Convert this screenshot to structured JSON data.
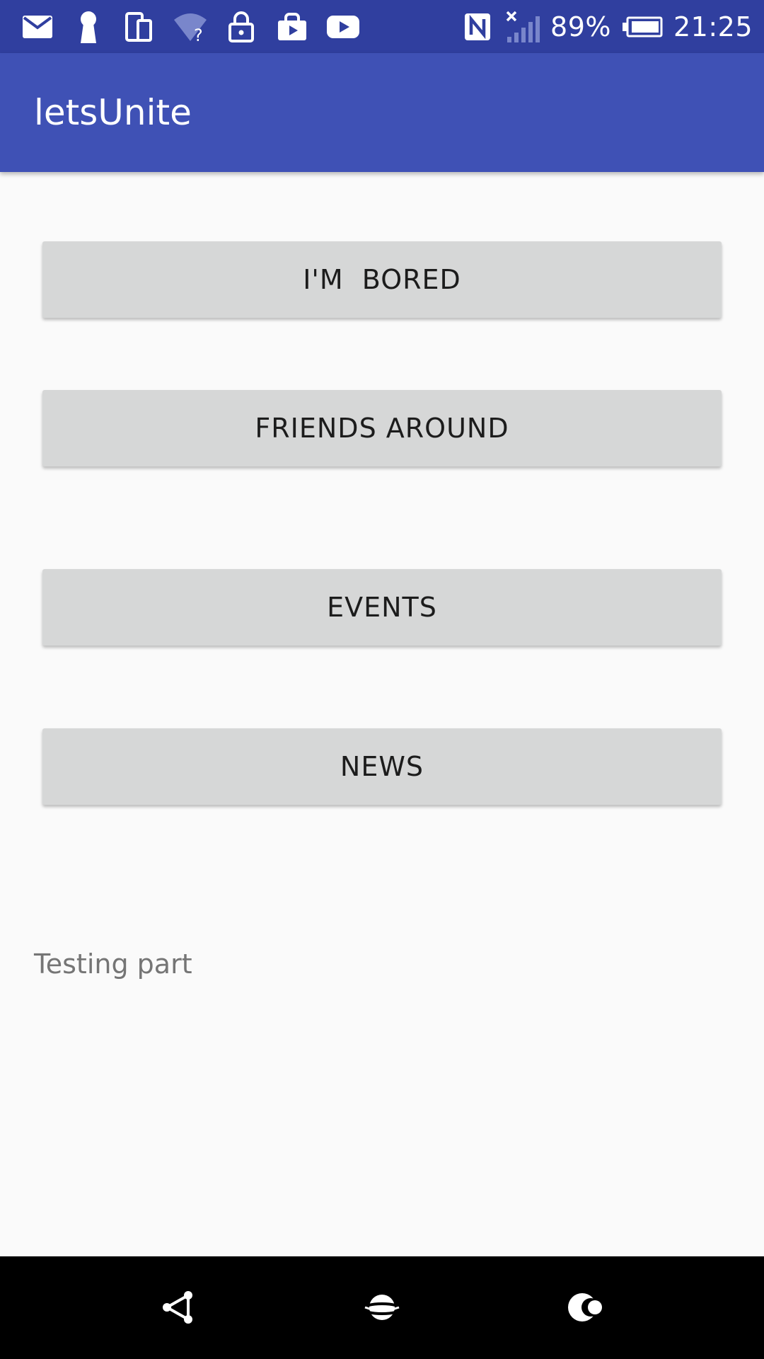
{
  "status_bar": {
    "icons_left": [
      "mail-icon",
      "keyhole-icon",
      "devices-icon",
      "wifi-question-icon",
      "lock-icon",
      "store-bag-icon",
      "youtube-icon"
    ],
    "icons_right": [
      "nfc-icon",
      "signal-off-icon",
      "battery-icon"
    ],
    "battery": "89%",
    "time": "21:25",
    "color": "#303f9f"
  },
  "app_bar": {
    "title": "letsUnite",
    "color": "#3f51b5"
  },
  "main": {
    "buttons": [
      {
        "label": "I'M  BORED"
      },
      {
        "label": "FRIENDS AROUND"
      },
      {
        "label": "EVENTS"
      },
      {
        "label": "NEWS"
      }
    ],
    "testing_text": "Testing part"
  },
  "nav_bar": {
    "buttons": [
      "share-node-icon",
      "planet-icon",
      "moon-icon"
    ]
  }
}
